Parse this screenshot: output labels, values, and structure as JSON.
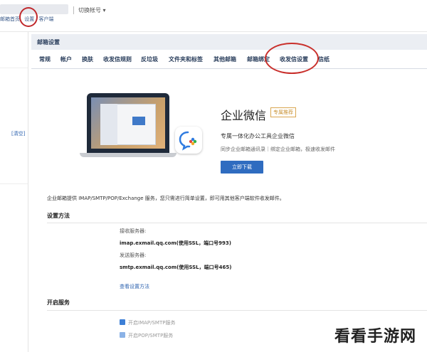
{
  "topbar": {
    "switch_account": "切换帐号 ▾",
    "links": [
      "邮箱首页",
      "设置",
      "客户端"
    ]
  },
  "sidebar": {
    "clear_link": "[清空]"
  },
  "settings": {
    "title": "邮箱设置",
    "tabs": [
      "常规",
      "帐户",
      "换肤",
      "收发信规则",
      "反垃圾",
      "文件夹和标签",
      "其他邮箱",
      "邮箱绑定",
      "收发信设置",
      "信纸"
    ],
    "active_tab": "收发信设置"
  },
  "banner": {
    "title": "企业微信",
    "badge": "专属推荐",
    "desc": "专属一体化办公工具企业微信",
    "sub": "同步企业邮箱通讯录｜绑定企业邮箱，极速收发邮件",
    "button": "立即下载"
  },
  "info": {
    "text": "企业邮箱提供 IMAP/SMTP/POP/Exchange 服务，您只需进行简单设置，即可用其他客户端软件收发邮件。"
  },
  "method": {
    "title": "设置方法",
    "incoming_label": "接收服务器:",
    "incoming_value": "imap.exmail.qq.com(使用SSL，端口号993)",
    "outgoing_label": "发送服务器:",
    "outgoing_value": "smtp.exmail.qq.com(使用SSL，端口号465)",
    "link": "查看设置方法"
  },
  "service": {
    "title": "开启服务",
    "options": [
      "开启IMAP/SMTP服务",
      "开启POP/SMTP服务"
    ]
  },
  "watermark": {
    "text": "看看手游网"
  },
  "colors": {
    "accent_blue": "#2f6cc0",
    "annotation_red": "#c9302c",
    "badge_gold": "#c89133"
  }
}
